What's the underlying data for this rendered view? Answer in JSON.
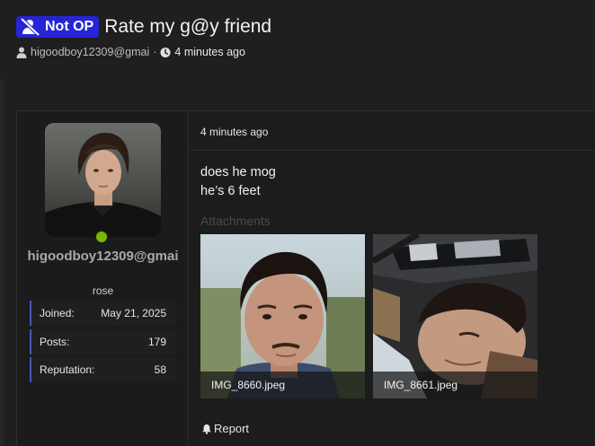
{
  "thread": {
    "badge_label": "Not OP",
    "title": "Rate my g@y friend",
    "author": "higoodboy12309@gmai",
    "time": "4 minutes ago"
  },
  "post": {
    "user": {
      "username": "higoodboy12309@gmai",
      "title": "rose",
      "online": true,
      "stats": [
        {
          "label": "Joined:",
          "value": "May 21, 2025"
        },
        {
          "label": "Posts:",
          "value": "179"
        },
        {
          "label": "Reputation:",
          "value": "58"
        }
      ]
    },
    "time": "4 minutes ago",
    "body": [
      "does he mog",
      "he’s 6 feet"
    ],
    "attachments_label": "Attachments",
    "attachments": [
      {
        "filename": "IMG_8660.jpeg"
      },
      {
        "filename": "IMG_8661.jpeg"
      }
    ],
    "report_label": "Report"
  },
  "colors": {
    "background": "#1f1f1f",
    "badge": "#2525d6",
    "online": "#76b900",
    "stat_accent": "#4a55b8"
  },
  "icons": {
    "badge": "user-slash-icon",
    "author": "user-icon",
    "time": "clock-icon",
    "report": "bell-icon"
  }
}
